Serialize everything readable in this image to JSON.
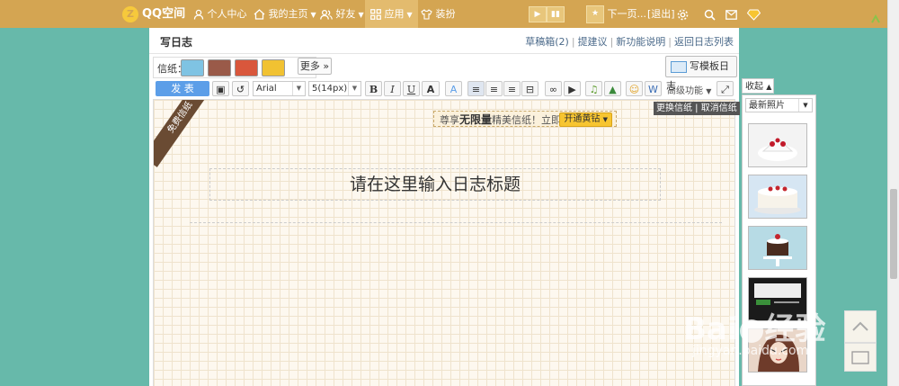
{
  "topbar": {
    "logo": "QQ空间",
    "nav": {
      "personal": "个人中心",
      "home": "我的主页",
      "friends": "好友",
      "apps": "应用",
      "dress": "装扮"
    },
    "music_next": "下一页...",
    "logout": "[退出]"
  },
  "page": {
    "title": "写日志",
    "links": {
      "drafts": "草稿箱(2)",
      "suggest": "提建议",
      "new_features": "新功能说明",
      "back": "返回日志列表"
    }
  },
  "stationery": {
    "label": "信纸：",
    "more": "更多",
    "template_button": "写模板日志"
  },
  "toolbar": {
    "publish": "发 表",
    "font": "Arial",
    "size": "5(14px)",
    "advanced": "高级功能"
  },
  "editor": {
    "ribbon": "免费信纸",
    "promo_text_1": "尊享",
    "promo_bold": "无限量",
    "promo_text_2": "精美信纸！立即",
    "promo_button": "开通黄钻",
    "title_placeholder": "请在这里输入日志标题",
    "change_paper": "更换信纸",
    "cancel_paper": "取消信纸"
  },
  "sidebar": {
    "tab": "收起",
    "select": "最新照片"
  },
  "watermark": {
    "main": "Bai",
    "tail": "经验",
    "sub": "jingyan.baidu.com"
  },
  "colors": {
    "topbar": "#d4a552",
    "background": "#67b9aa",
    "publish": "#5c9ee8"
  }
}
